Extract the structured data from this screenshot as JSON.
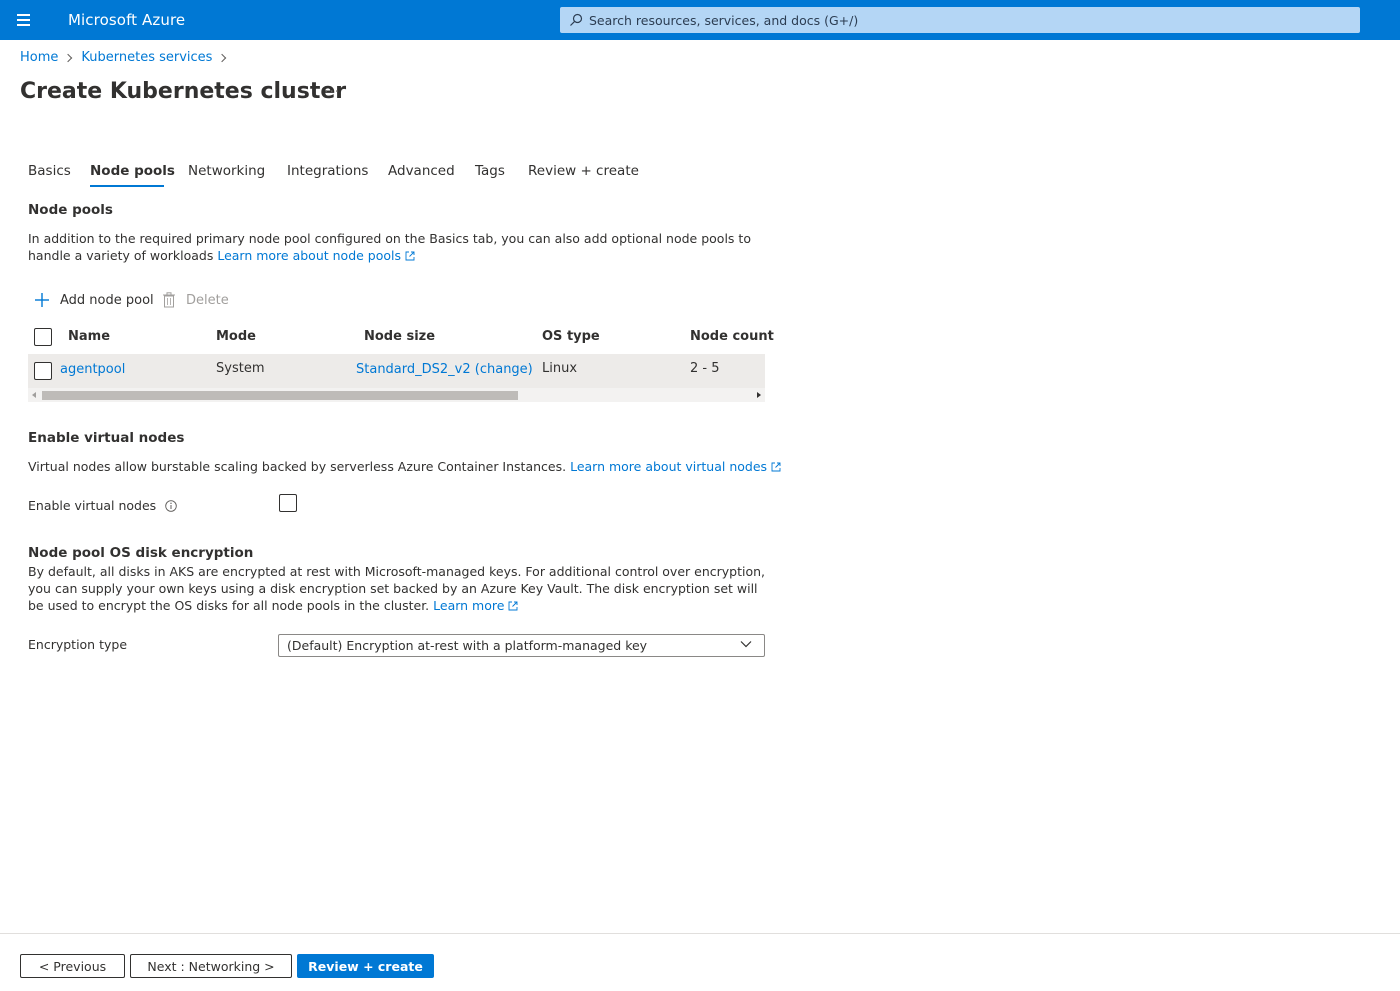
{
  "app": {
    "title": "Microsoft Azure"
  },
  "search": {
    "placeholder": "Search resources, services, and docs (G+/)"
  },
  "breadcrumb": {
    "items": [
      "Home",
      "Kubernetes services"
    ]
  },
  "page": {
    "title": "Create Kubernetes cluster",
    "more": "···"
  },
  "tabs": {
    "items": [
      "Basics",
      "Node pools",
      "Networking",
      "Integrations",
      "Advanced",
      "Tags",
      "Review + create"
    ],
    "active": "Node pools"
  },
  "node_pools": {
    "heading": "Node pools",
    "description": "In addition to the required primary node pool configured on the Basics tab, you can also add optional node pools to handle a variety of workloads",
    "learn_more": "Learn more about node pools",
    "add_label": "Add node pool",
    "delete_label": "Delete",
    "columns": [
      "Name",
      "Mode",
      "Node size",
      "OS type",
      "Node count"
    ],
    "rows": [
      {
        "name": "agentpool",
        "mode": "System",
        "node_size": "Standard_DS2_v2 (change)",
        "os_type": "Linux",
        "node_count": "2 - 5"
      }
    ]
  },
  "virtual_nodes": {
    "heading": "Enable virtual nodes",
    "description": "Virtual nodes allow burstable scaling backed by serverless Azure Container Instances.",
    "learn_more": "Learn more about virtual nodes",
    "field_label": "Enable virtual nodes",
    "checked": false
  },
  "encryption": {
    "heading": "Node pool OS disk encryption",
    "description": "By default, all disks in AKS are encrypted at rest with Microsoft-managed keys. For additional control over encryption, you can supply your own keys using a disk encryption set backed by an Azure Key Vault. The disk encryption set will be used to encrypt the OS disks for all node pools in the cluster.",
    "learn_more": "Learn more",
    "field_label": "Encryption type",
    "selected": "(Default) Encryption at-rest with a platform-managed key"
  },
  "footer": {
    "previous": "< Previous",
    "next": "Next : Networking >",
    "review": "Review + create"
  },
  "colors": {
    "brand": "#0078d4",
    "search_bg": "#b4d6f5",
    "row_bg": "#edebe9"
  }
}
